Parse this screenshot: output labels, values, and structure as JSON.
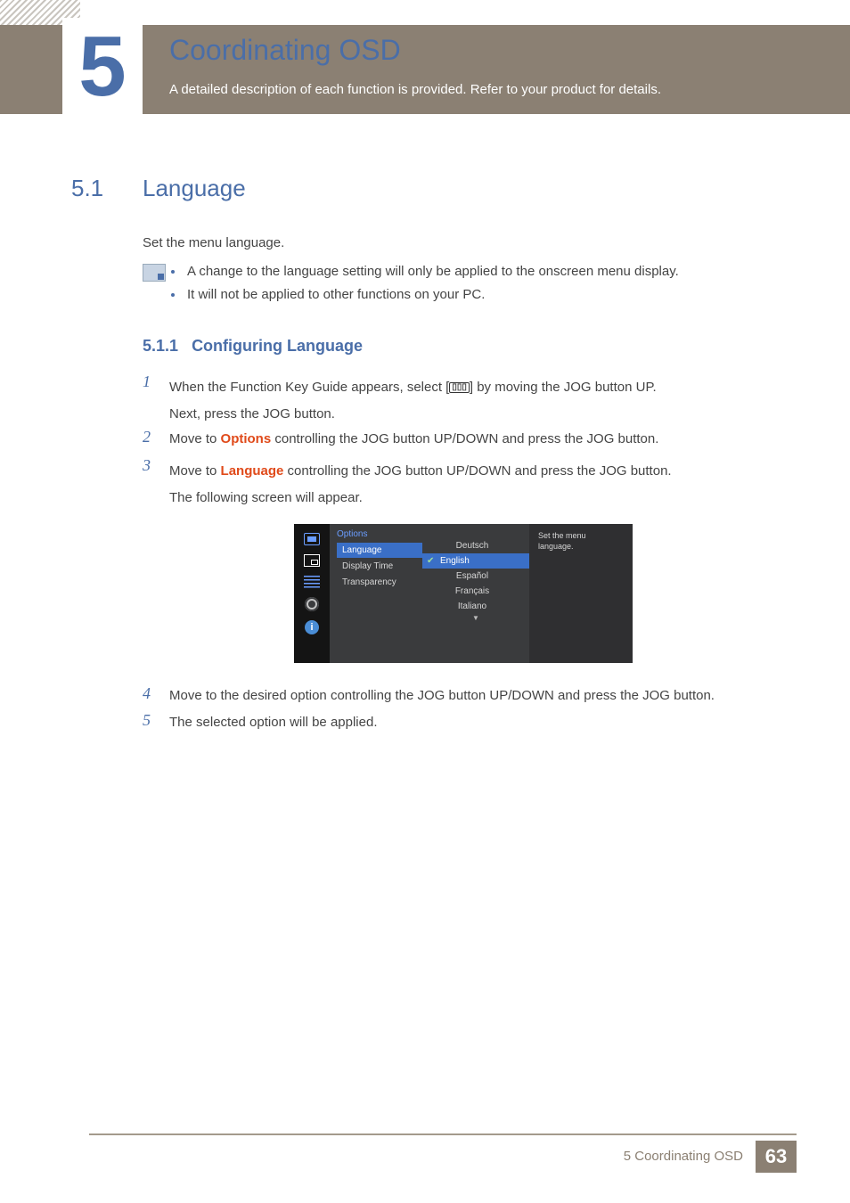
{
  "chapter": {
    "number": "5",
    "title": "Coordinating OSD",
    "description": "A detailed description of each function is provided. Refer to your product for details."
  },
  "section": {
    "number": "5.1",
    "title": "Language",
    "intro": "Set the menu language.",
    "notes": [
      "A change to the language setting will only be applied to the onscreen menu display.",
      "It will not be applied to other functions on your PC."
    ]
  },
  "subsection": {
    "number": "5.1.1",
    "title": "Configuring Language"
  },
  "steps": {
    "s1a": "When the Function Key Guide appears, select [",
    "s1b": "] by moving the JOG button UP.",
    "s1c": "Next, press the JOG button.",
    "s2a": "Move to ",
    "s2hl": "Options",
    "s2b": " controlling the JOG button UP/DOWN and press the JOG button.",
    "s3a": "Move to ",
    "s3hl": "Language",
    "s3b": " controlling the JOG button UP/DOWN and press the JOG button.",
    "s3c": "The following screen will appear.",
    "s4": "Move to the desired option controlling the JOG button UP/DOWN and press the JOG button.",
    "s5": "The selected option will be applied."
  },
  "step_nums": {
    "n1": "1",
    "n2": "2",
    "n3": "3",
    "n4": "4",
    "n5": "5"
  },
  "osd": {
    "heading": "Options",
    "menu": [
      "Language",
      "Display Time",
      "Transparency"
    ],
    "languages": [
      "Deutsch",
      "English",
      "Español",
      "Français",
      "Italiano"
    ],
    "selected_language": "English",
    "help1": "Set the menu",
    "help2": "language.",
    "info_glyph": "i"
  },
  "footer": {
    "text": "5 Coordinating OSD",
    "page": "63"
  }
}
